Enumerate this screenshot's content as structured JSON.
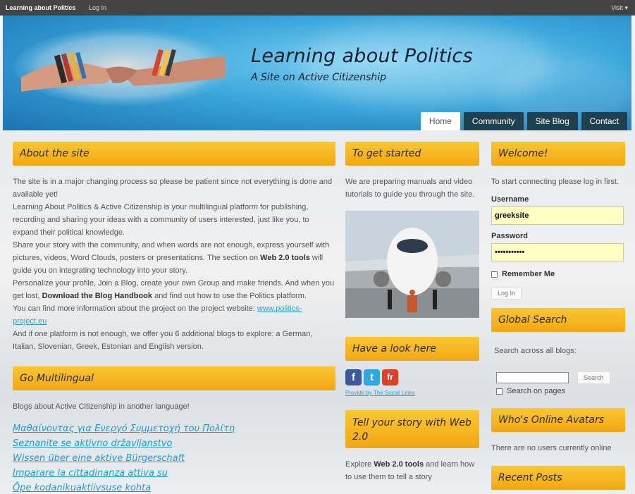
{
  "adminbar": {
    "site": "Learning about Politics",
    "login": "Log In",
    "visit": "Visit"
  },
  "header": {
    "title": "Learning about Politics",
    "tagline": "A Site on Active Citizenship",
    "nav": [
      "Home",
      "Community",
      "Site Blog",
      "Contact"
    ]
  },
  "about": {
    "title": "About the site",
    "p1": "The site is in a major changing process so please be patient since not everything is done and available yet!",
    "p2": "Learning About Politics & Active Citizenship is your multilingual platform for publishing, recording and sharing your ideas with a community of users interested, just like you, to expand their political knowledge.",
    "p3a": "Share your story with the community, and when words are not enough, express yourself with pictures, videos, Word Clouds, posters or presentations. The section on ",
    "p3b": "Web 2.0 tools",
    "p3c": " will guide you on integrating technology into your story.",
    "p4a": "Personalize your profile, Join a Blog, create your own Group and make friends. And when you get lost, ",
    "p4b": "Download the Blog Handbook",
    "p4c": " and find out how to use the Politics platform.",
    "p5a": "You can find more information about the project on the project website: ",
    "p5link": "www.politics-project.eu",
    "p6": "And if one platform is not enough, we offer you 6 additional blogs to explore: a German, Italian, Slovenian, Greek, Estonian and English version."
  },
  "multilingual": {
    "title": "Go Multilingual",
    "intro": "Blogs about Active Citizenship in another language!",
    "links": [
      "Μαθαίνοντας για Ενεργό Συμμετοχή του Πολίτη",
      "Seznanite se aktivno državljanstvo",
      "Wissen über eine aktive Bürgerschaft",
      "Imparare la cittadinanza attiva su",
      "Õpe kodanikuaktiivsuse kohta"
    ]
  },
  "started": {
    "title": "To get started",
    "body": "We are preparing manuals and video tutorials to guide you through the site."
  },
  "look": {
    "title": "Have a look here",
    "social": [
      "f",
      "t",
      "fr"
    ],
    "credit": "Provide by The Social Links"
  },
  "tell": {
    "title": "Tell your story with Web 2.0",
    "body_a": "Explore ",
    "body_b": "Web 2.0 tools",
    "body_c": " and learn how to use them to tell a story"
  },
  "welcome": {
    "title": "Welcome!",
    "body": "To start connecting please log in first.",
    "username_label": "Username",
    "username_value": "greeksite",
    "password_label": "Password",
    "password_value": "•••••••••••",
    "remember": "Remember Me",
    "login_button": "Log In"
  },
  "search": {
    "title": "Global Search",
    "desc": "Search across all blogs:",
    "button": "Search",
    "pages_label": "Search on pages"
  },
  "online": {
    "title": "Who's Online Avatars",
    "body": "There are no users currently online"
  },
  "recent": {
    "title": "Recent Posts"
  },
  "colors": {
    "accent": "#f2a713",
    "nav_dark": "#20404f",
    "link": "#2ba3d3",
    "facebook": "#3b5998",
    "twitter": "#2fa8de",
    "friendfeed": "#d9432a"
  }
}
